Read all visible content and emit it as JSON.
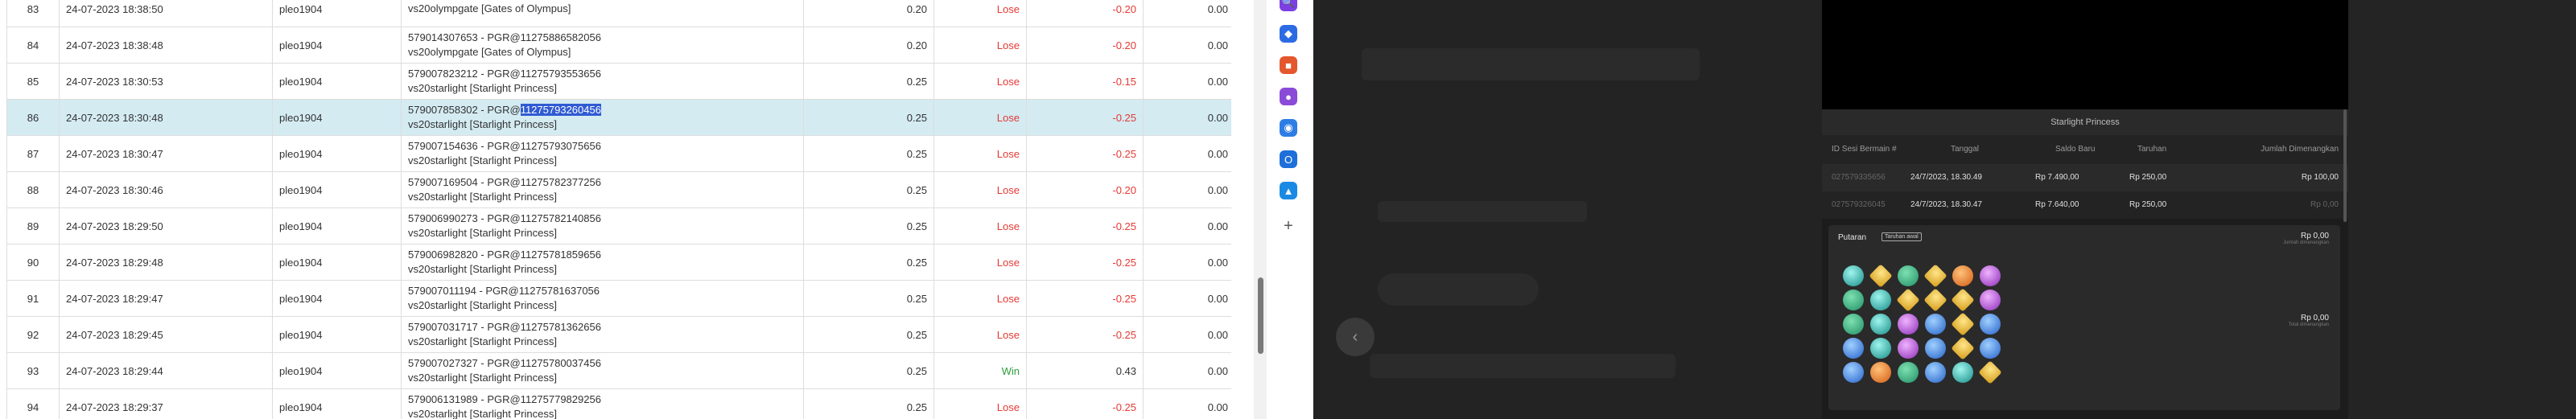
{
  "table": {
    "rows": [
      {
        "no": "83",
        "time": "24-07-2023 18:38:50",
        "user": "pleo1904",
        "desc1": "",
        "desc2": "vs20olympgate [Gates of Olympus]",
        "bet": "0.20",
        "result": "Lose",
        "win": "-0.20",
        "balance": "0.00"
      },
      {
        "no": "84",
        "time": "24-07-2023 18:38:48",
        "user": "pleo1904",
        "desc1": "579014307653 - PGR@11275886582056",
        "desc2": "vs20olympgate [Gates of Olympus]",
        "bet": "0.20",
        "result": "Lose",
        "win": "-0.20",
        "balance": "0.00"
      },
      {
        "no": "85",
        "time": "24-07-2023 18:30:53",
        "user": "pleo1904",
        "desc1": "579007823212 - PGR@11275793553656",
        "desc2": "vs20starlight [Starlight Princess]",
        "bet": "0.25",
        "result": "Lose",
        "win": "-0.15",
        "balance": "0.00"
      },
      {
        "no": "86",
        "time": "24-07-2023 18:30:48",
        "user": "pleo1904",
        "desc1_prefix": "579007858302 - PGR@",
        "desc1_highlight": "11275793260456",
        "desc2": "vs20starlight [Starlight Princess]",
        "bet": "0.25",
        "result": "Lose",
        "win": "-0.25",
        "balance": "0.00",
        "selected": true
      },
      {
        "no": "87",
        "time": "24-07-2023 18:30:47",
        "user": "pleo1904",
        "desc1": "579007154636 - PGR@11275793075656",
        "desc2": "vs20starlight [Starlight Princess]",
        "bet": "0.25",
        "result": "Lose",
        "win": "-0.25",
        "balance": "0.00"
      },
      {
        "no": "88",
        "time": "24-07-2023 18:30:46",
        "user": "pleo1904",
        "desc1": "579007169504 - PGR@11275782377256",
        "desc2": "vs20starlight [Starlight Princess]",
        "bet": "0.25",
        "result": "Lose",
        "win": "-0.20",
        "balance": "0.00"
      },
      {
        "no": "89",
        "time": "24-07-2023 18:29:50",
        "user": "pleo1904",
        "desc1": "579006990273 - PGR@11275782140856",
        "desc2": "vs20starlight [Starlight Princess]",
        "bet": "0.25",
        "result": "Lose",
        "win": "-0.25",
        "balance": "0.00"
      },
      {
        "no": "90",
        "time": "24-07-2023 18:29:48",
        "user": "pleo1904",
        "desc1": "579006982820 - PGR@11275781859656",
        "desc2": "vs20starlight [Starlight Princess]",
        "bet": "0.25",
        "result": "Lose",
        "win": "-0.25",
        "balance": "0.00"
      },
      {
        "no": "91",
        "time": "24-07-2023 18:29:47",
        "user": "pleo1904",
        "desc1": "579007011194 - PGR@11275781637056",
        "desc2": "vs20starlight [Starlight Princess]",
        "bet": "0.25",
        "result": "Lose",
        "win": "-0.25",
        "balance": "0.00"
      },
      {
        "no": "92",
        "time": "24-07-2023 18:29:45",
        "user": "pleo1904",
        "desc1": "579007031717 - PGR@11275781362656",
        "desc2": "vs20starlight [Starlight Princess]",
        "bet": "0.25",
        "result": "Lose",
        "win": "-0.25",
        "balance": "0.00"
      },
      {
        "no": "93",
        "time": "24-07-2023 18:29:44",
        "user": "pleo1904",
        "desc1": "579007027327 - PGR@11275780037456",
        "desc2": "vs20starlight [Starlight Princess]",
        "bet": "0.25",
        "result": "Win",
        "win": "0.43",
        "balance": "0.00"
      },
      {
        "no": "94",
        "time": "24-07-2023 18:29:37",
        "user": "pleo1904",
        "desc1": "579006131989 - PGR@11275779829256",
        "desc2": "vs20starlight [Starlight Princess]",
        "bet": "0.25",
        "result": "Lose",
        "win": "-0.25",
        "balance": "0.00"
      }
    ]
  },
  "side_strip": {
    "icons": [
      {
        "name": "search-icon",
        "glyph": "🔍",
        "color": "#7b3fe4"
      },
      {
        "name": "tag-icon",
        "glyph": "◆",
        "color": "#2d6be4"
      },
      {
        "name": "toolbox-icon",
        "glyph": "■",
        "color": "#e4572e"
      },
      {
        "name": "user-icon",
        "glyph": "●",
        "color": "#8a4bd8"
      },
      {
        "name": "copilot-icon",
        "glyph": "◉",
        "color": "#2e7de4"
      },
      {
        "name": "outlook-icon",
        "glyph": "O",
        "color": "#1e6fd9"
      },
      {
        "name": "shopping-icon",
        "glyph": "▲",
        "color": "#1b8ae4"
      }
    ],
    "add_glyph": "+"
  },
  "game": {
    "title": "Starlight Princess",
    "headers": {
      "id": "ID Sesi Bermain #",
      "date": "Tanggal",
      "balance": "Saldo Baru",
      "bet": "Taruhan",
      "win": "Jumlah Dimenangkan"
    },
    "rows": [
      {
        "id": "027579335656",
        "date": "24/7/2023, 18.30.49",
        "balance": "Rp 7.490,00",
        "bet": "Rp 250,00",
        "win": "Rp 100,00"
      },
      {
        "id": "027579326045",
        "date": "24/7/2023, 18.30.47",
        "balance": "Rp 7.640,00",
        "bet": "Rp 250,00",
        "win": "Rp 0,00"
      }
    ],
    "round_label": "Putaran",
    "round_badge": "Taruhan awal",
    "round_win_1": "Rp 0,00",
    "round_win_1_sub": "Jumlah dimenangkan",
    "round_win_2": "Rp 0,00",
    "round_win_2_sub": "Total dimenangkan",
    "reels": [
      [
        "teal",
        "yellow",
        "green",
        "yellow",
        "orange",
        "purple"
      ],
      [
        "green",
        "teal",
        "yellow",
        "yellow",
        "yellow",
        "purple"
      ],
      [
        "green",
        "teal",
        "purple",
        "blue",
        "yellow",
        "blue"
      ],
      [
        "blue",
        "teal",
        "purple",
        "blue",
        "yellow",
        "blue"
      ],
      [
        "blue",
        "orange",
        "green",
        "blue",
        "teal",
        "yellow"
      ]
    ]
  },
  "viewer": {
    "prev_glyph": "‹"
  }
}
